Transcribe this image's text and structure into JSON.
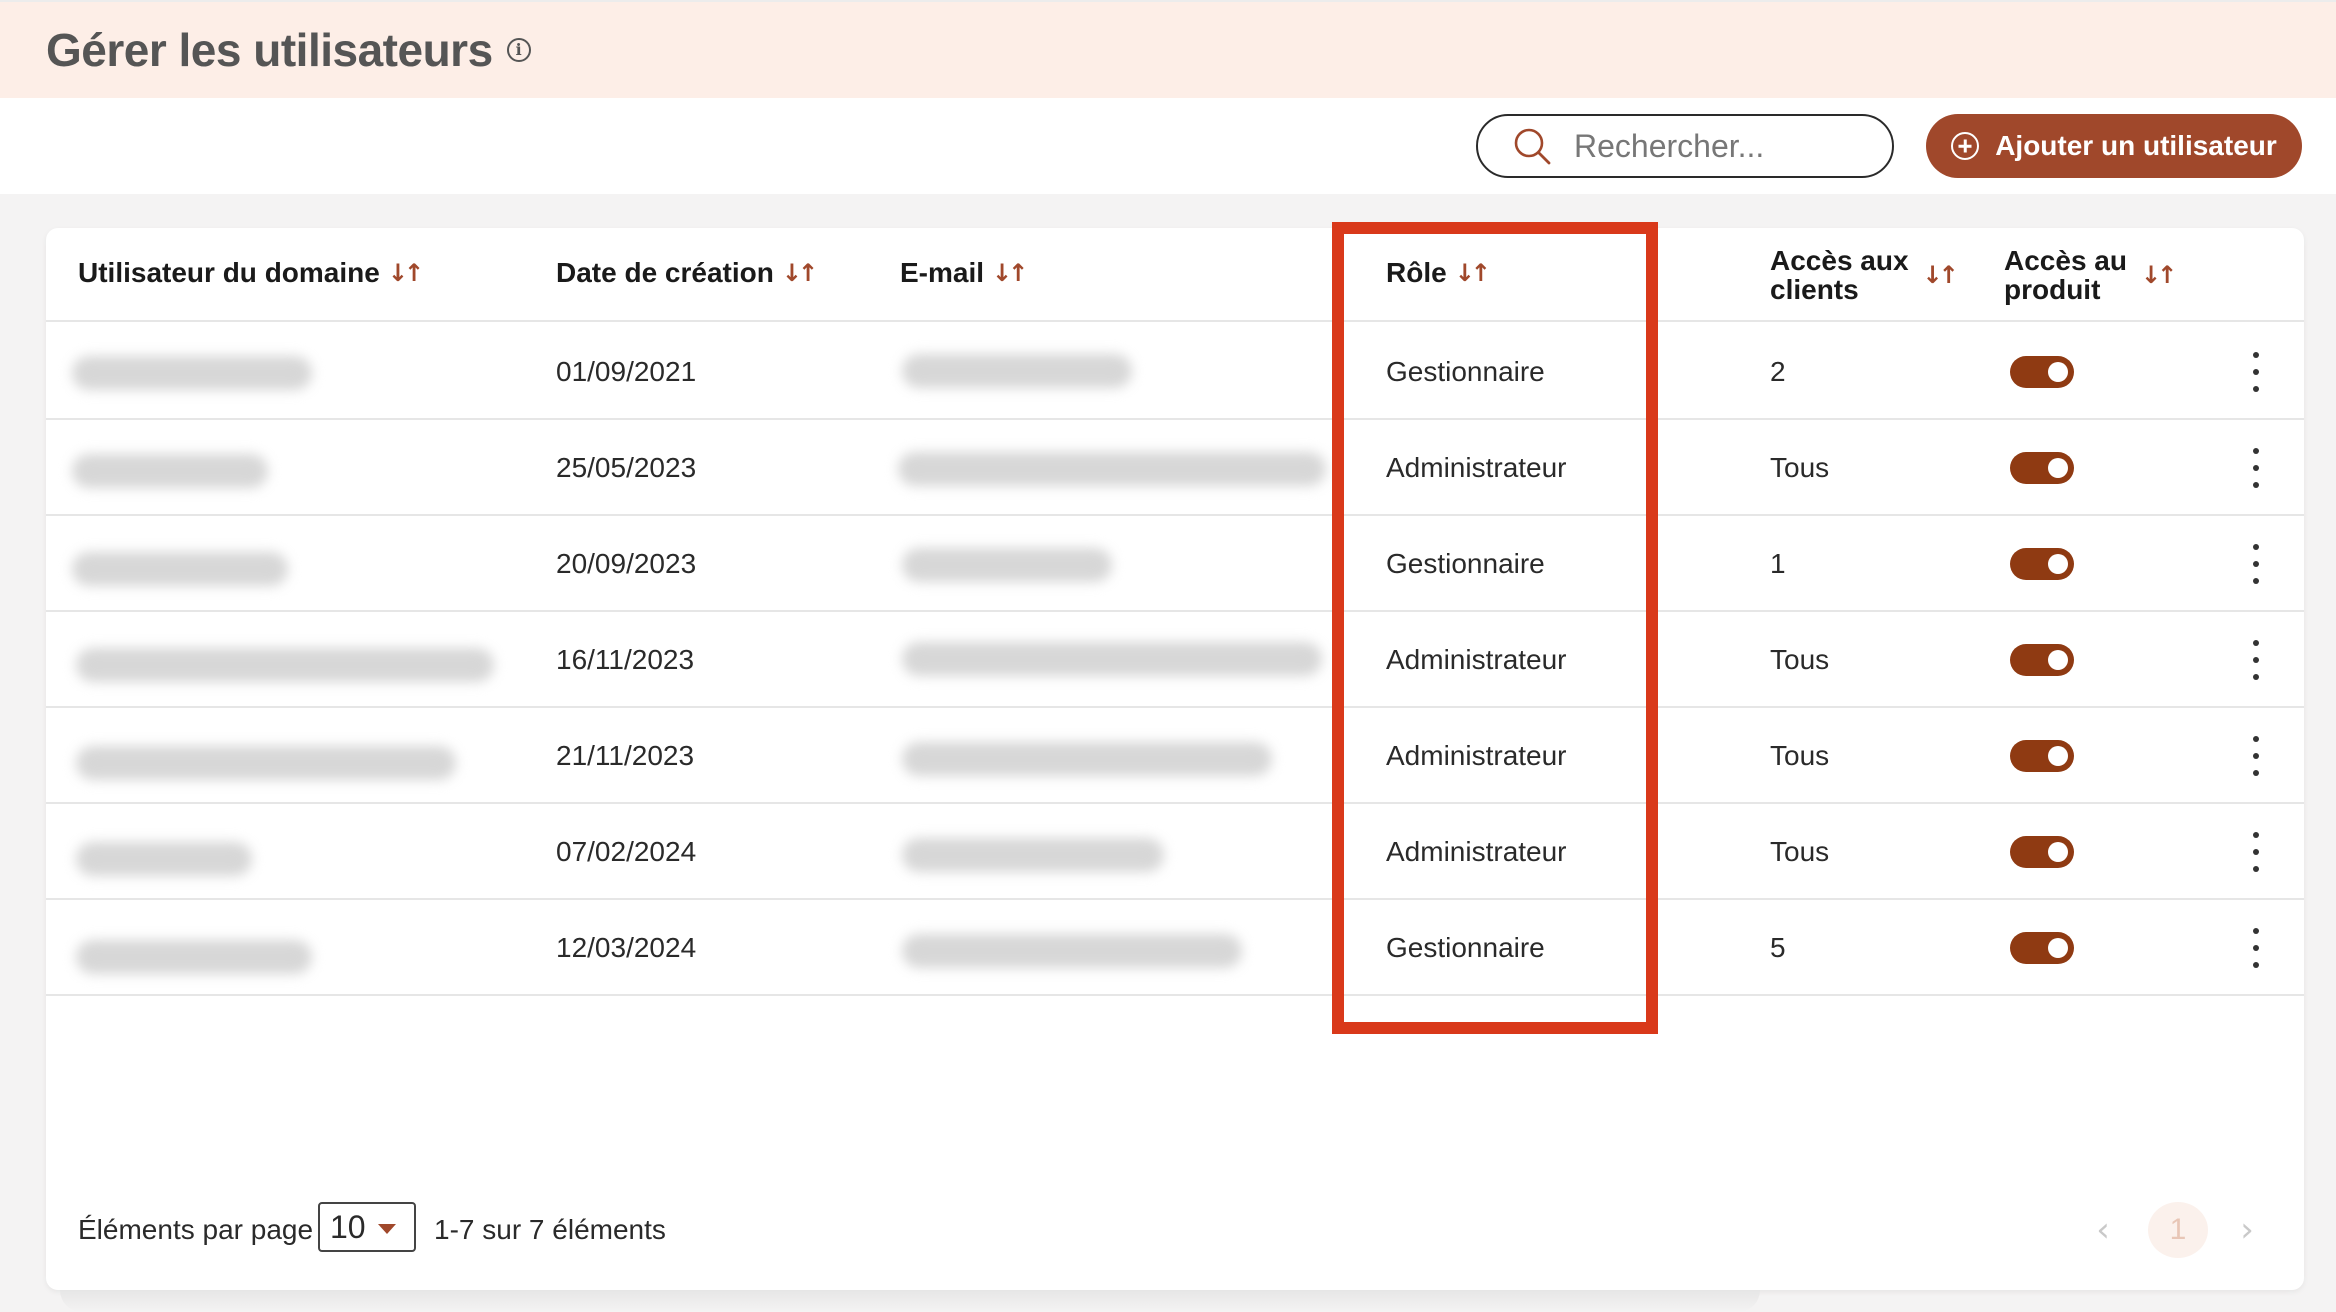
{
  "header": {
    "title": "Gérer les utilisateurs",
    "info_icon": "info-icon",
    "info_glyph": "i"
  },
  "toolbar": {
    "search_placeholder": "Rechercher...",
    "add_user_label": "Ajouter un utilisateur",
    "accent_color": "#a0482b"
  },
  "table": {
    "columns": [
      {
        "label": "Utilisateur du domaine"
      },
      {
        "label": "Date de création"
      },
      {
        "label": "E-mail"
      },
      {
        "label": "Rôle"
      },
      {
        "label_line1": "Accès aux",
        "label_line2": "clients"
      },
      {
        "label_line1": "Accès au",
        "label_line2": "produit"
      }
    ],
    "sort_glyph": "↓↑",
    "rows": [
      {
        "date": "01/09/2021",
        "role": "Gestionnaire",
        "clients": "2",
        "product_access": true
      },
      {
        "date": "25/05/2023",
        "role": "Administrateur",
        "clients": "Tous",
        "product_access": true
      },
      {
        "date": "20/09/2023",
        "role": "Gestionnaire",
        "clients": "1",
        "product_access": true
      },
      {
        "date": "16/11/2023",
        "role": "Administrateur",
        "clients": "Tous",
        "product_access": true
      },
      {
        "date": "21/11/2023",
        "role": "Administrateur",
        "clients": "Tous",
        "product_access": true
      },
      {
        "date": "07/02/2024",
        "role": "Administrateur",
        "clients": "Tous",
        "product_access": true
      },
      {
        "date": "12/03/2024",
        "role": "Gestionnaire",
        "clients": "5",
        "product_access": true
      }
    ]
  },
  "footer": {
    "per_page_label": "Éléments par page",
    "per_page_value": "10",
    "range_text": "1-7 sur 7 éléments",
    "current_page": "1",
    "prev_glyph": "‹",
    "next_glyph": "›"
  },
  "colors": {
    "header_bg": "#fdeee7",
    "toggle_on": "#8f3a12",
    "highlight": "#d9391a"
  }
}
